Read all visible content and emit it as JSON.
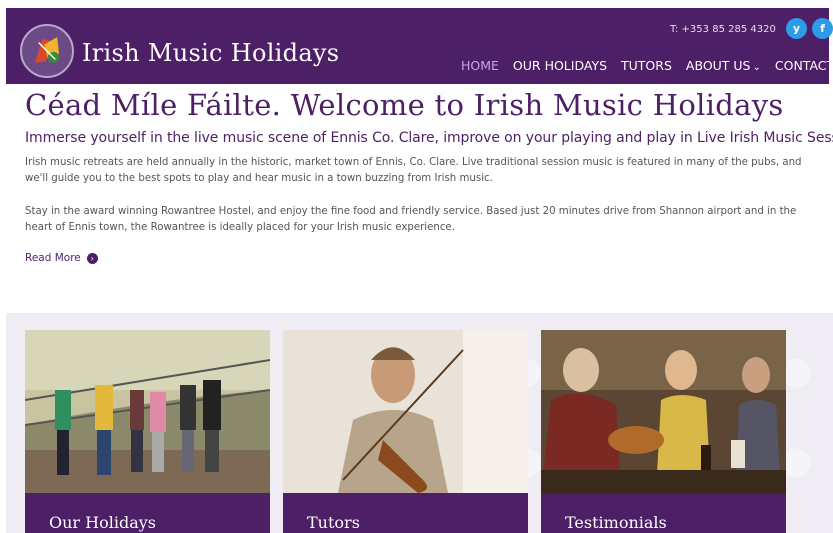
{
  "brand": {
    "name": "Irish Music Holidays"
  },
  "contact": {
    "phone": "T: +353 85 285 4320"
  },
  "social": {
    "twitter": "y",
    "facebook": "f"
  },
  "nav": {
    "items": [
      "HOME",
      "OUR HOLIDAYS",
      "TUTORS",
      "ABOUT US",
      "CONTACT US"
    ],
    "active": "HOME",
    "about_chevron": "⌄"
  },
  "main": {
    "title": "Céad Míle Fáilte. Welcome to Irish Music Holidays",
    "subtitle": "Immerse yourself in the live music scene of Ennis Co. Clare, improve on your playing and play in Live Irish Music Sessions.",
    "paragraph1": "Irish music retreats are held annually in the historic, market town of Ennis, Co. Clare. Live traditional session music is featured in many of the pubs, and we'll guide you to the best spots to play and hear music in a town buzzing from Irish music.",
    "paragraph2": "Stay in the award winning Rowantree Hostel, and enjoy the fine food and friendly service. Based just 20 minutes drive from Shannon airport and in the heart of Ennis town, the Rowantree is ideally placed for your Irish music experience.",
    "read_more": "Read More",
    "read_more_icon": "›"
  },
  "cards": [
    {
      "label": "Our Holidays"
    },
    {
      "label": "Tutors"
    },
    {
      "label": "Testimonials"
    }
  ],
  "colors": {
    "primary": "#4d1f66",
    "nav_active": "#c8a6e0",
    "social": "#2c9be8"
  }
}
